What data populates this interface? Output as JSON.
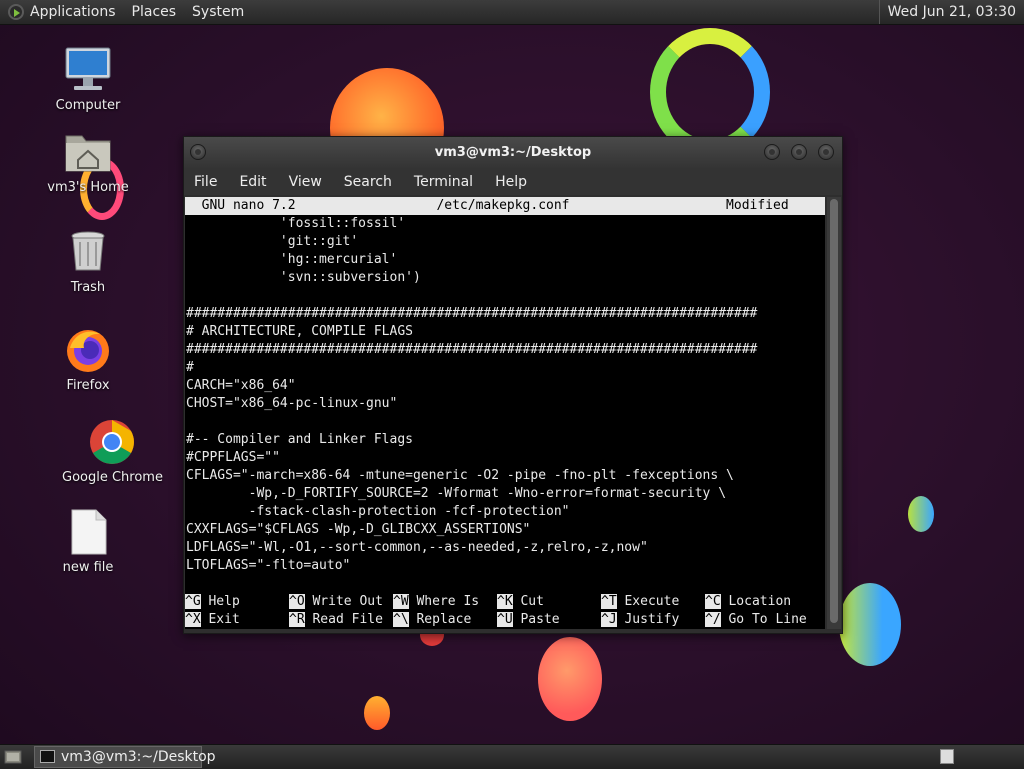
{
  "top_panel": {
    "menus": [
      "Applications",
      "Places",
      "System"
    ],
    "clock": "Wed Jun 21, 03:30"
  },
  "desktop_icons": [
    {
      "label": "Computer"
    },
    {
      "label": "vm3's Home"
    },
    {
      "label": "Trash"
    },
    {
      "label": "Firefox"
    },
    {
      "label": "Google Chrome"
    },
    {
      "label": "new file"
    }
  ],
  "window": {
    "title": "vm3@vm3:~/Desktop",
    "menu": [
      "File",
      "Edit",
      "View",
      "Search",
      "Terminal",
      "Help"
    ]
  },
  "nano": {
    "header": "  GNU nano 7.2                  /etc/makepkg.conf                    Modified",
    "lines": [
      "            'fossil::fossil'",
      "            'git::git'",
      "            'hg::mercurial'",
      "            'svn::subversion')",
      "",
      "#########################################################################",
      "# ARCHITECTURE, COMPILE FLAGS",
      "#########################################################################",
      "#",
      "CARCH=\"x86_64\"",
      "CHOST=\"x86_64-pc-linux-gnu\"",
      "",
      "#-- Compiler and Linker Flags",
      "#CPPFLAGS=\"\"",
      "CFLAGS=\"-march=x86-64 -mtune=generic -O2 -pipe -fno-plt -fexceptions \\",
      "        -Wp,-D_FORTIFY_SOURCE=2 -Wformat -Wno-error=format-security \\",
      "        -fstack-clash-protection -fcf-protection\"",
      "CXXFLAGS=\"$CFLAGS -Wp,-D_GLIBCXX_ASSERTIONS\"",
      "LDFLAGS=\"-Wl,-O1,--sort-common,--as-needed,-z,relro,-z,now\"",
      "LTOFLAGS=\"-flto=auto\"",
      ""
    ],
    "shortcuts_row1": [
      {
        "key": "^G",
        "label": "Help"
      },
      {
        "key": "^O",
        "label": "Write Out"
      },
      {
        "key": "^W",
        "label": "Where Is"
      },
      {
        "key": "^K",
        "label": "Cut"
      },
      {
        "key": "^T",
        "label": "Execute"
      },
      {
        "key": "^C",
        "label": "Location"
      }
    ],
    "shortcuts_row2": [
      {
        "key": "^X",
        "label": "Exit"
      },
      {
        "key": "^R",
        "label": "Read File"
      },
      {
        "key": "^\\",
        "label": "Replace"
      },
      {
        "key": "^U",
        "label": "Paste"
      },
      {
        "key": "^J",
        "label": "Justify"
      },
      {
        "key": "^/",
        "label": "Go To Line"
      }
    ]
  },
  "taskbar": {
    "task_label": "vm3@vm3:~/Desktop"
  }
}
